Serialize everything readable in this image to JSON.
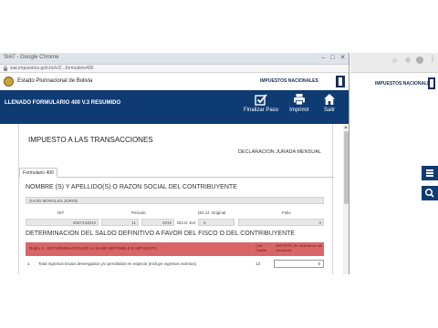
{
  "popup": {
    "window_title": "SIAT - Google Chrome",
    "url": "siat.impuestos.gob.bo/v2/...formulario400",
    "header": {
      "state_name": "Estado Plurinacional de Bolivia",
      "agency": "IMPUESTOS NACIONALES"
    },
    "toolbar": {
      "form_title": "LLENADO FORMULARIO 400 V.3 RESUMIDO",
      "buttons": [
        {
          "label": "Finalizar Paso",
          "icon": "finish-check-icon"
        },
        {
          "label": "Imprimir",
          "icon": "printer-icon"
        },
        {
          "label": "Salir",
          "icon": "home-icon"
        }
      ]
    },
    "form": {
      "tax_title": "IMPUESTO A LAS TRANSACCIONES",
      "declaration_type": "DECLARACION JURADA MENSUAL",
      "tab_label": "Formulario 400",
      "name_section": "NOMBRE (S) Y APELLIDO(S) O RAZON SOCIAL DEL CONTRIBUYENTE",
      "taxpayer_name": "DAVID MORALES JORGE",
      "field_labels": {
        "nit": "NIT",
        "periodo": "Periodo",
        "ddjj": "DD.JJ. Original",
        "folio": "Folio",
        "ddjj_short": "DDJJ. Ext"
      },
      "field_values": {
        "nit": "5567443013",
        "month": "11",
        "year": "2019",
        "original": "0",
        "folio": "0"
      },
      "detail_section": "DETERMINACION DEL SALDO DEFINITIVO A FAVOR DEL FISCO O DEL CONTRIBUYENTE",
      "detail_header": {
        "col_rubro": "Rubro 1 - DETERMINACION DE LA BASE IMPONIBLE E IMPUESTO",
        "col_code": "Cod. Casilla",
        "col_amount": "IMPORTE (En Bolivianos sin centavos)"
      },
      "rows": [
        {
          "num": "1",
          "text": "Total ingresos brutos devengados y/o percibidos en especie (Incluye ingresos exentos)",
          "code": "13",
          "value": "0"
        }
      ]
    }
  },
  "background": {
    "agency": "IMPUESTOS NACIONALES"
  },
  "colors": {
    "navy": "#0f3b73",
    "header_red": "#d96666"
  }
}
